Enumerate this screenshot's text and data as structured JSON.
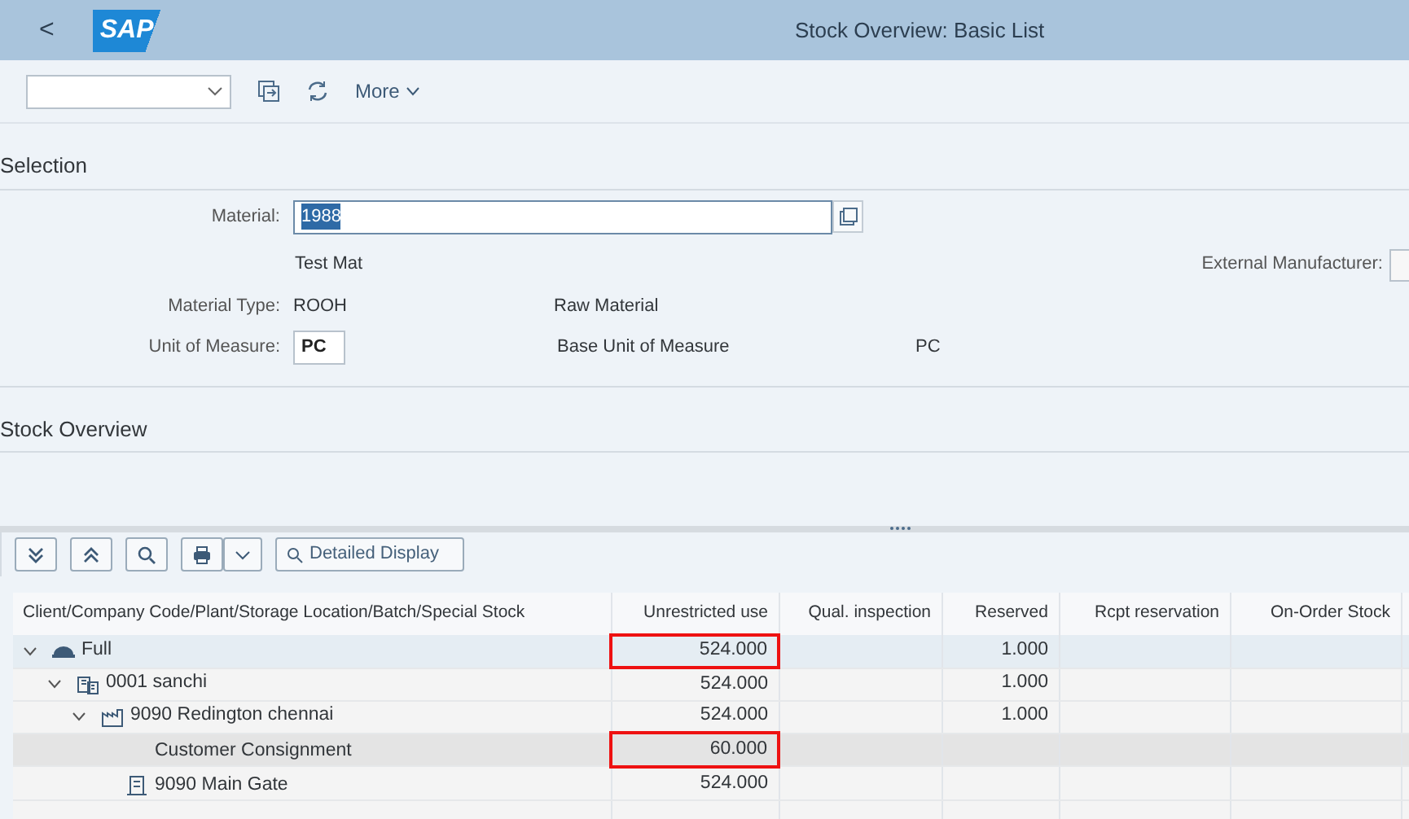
{
  "header": {
    "back": "<",
    "logo": "SAP",
    "title": "Stock Overview: Basic List"
  },
  "toolbar": {
    "more": "More"
  },
  "selection": {
    "title": "Selection",
    "material": {
      "label": "Material:",
      "value": "1988",
      "text_selected": true
    },
    "material_description": "Test Mat",
    "external_manufacturer": {
      "label": "External Manufacturer:"
    },
    "material_type": {
      "label": "Material Type:",
      "value": "ROOH",
      "description": "Raw Material"
    },
    "unit": {
      "label": "Unit of Measure:",
      "value": "PC",
      "base_label": "Base Unit of Measure",
      "base_value": "PC"
    }
  },
  "stock_overview": {
    "title": "Stock Overview",
    "toolbar": {
      "detailed_display": "Detailed Display"
    },
    "table": {
      "columns": [
        "Client/Company Code/Plant/Storage Location/Batch/Special Stock",
        "Unrestricted use",
        "Qual. inspection",
        "Reserved",
        "Rcpt reservation",
        "On-Order Stock"
      ],
      "rows": [
        {
          "label": "Full",
          "kind": "client",
          "expanded": true,
          "selected": true,
          "hovered": false,
          "circled": true,
          "unrestricted_use": "524.000",
          "reserved": "1.000",
          "children": [
            {
              "label": "0001 sanchi",
              "kind": "company",
              "expanded": true,
              "selected": false,
              "hovered": false,
              "circled": false,
              "unrestricted_use": "524.000",
              "reserved": "1.000",
              "children": [
                {
                  "label": "9090 Redington chennai",
                  "kind": "plant",
                  "expanded": true,
                  "selected": false,
                  "hovered": false,
                  "circled": false,
                  "unrestricted_use": "524.000",
                  "reserved": "1.000",
                  "children": [
                    {
                      "label": "Customer Consignment",
                      "kind": "special_stock",
                      "selected": false,
                      "hovered": true,
                      "circled": true,
                      "unrestricted_use": "60.000"
                    },
                    {
                      "label": "9090 Main Gate",
                      "kind": "storage_location",
                      "selected": false,
                      "hovered": false,
                      "circled": false,
                      "unrestricted_use": "524.000"
                    }
                  ]
                }
              ]
            }
          ]
        }
      ]
    }
  }
}
